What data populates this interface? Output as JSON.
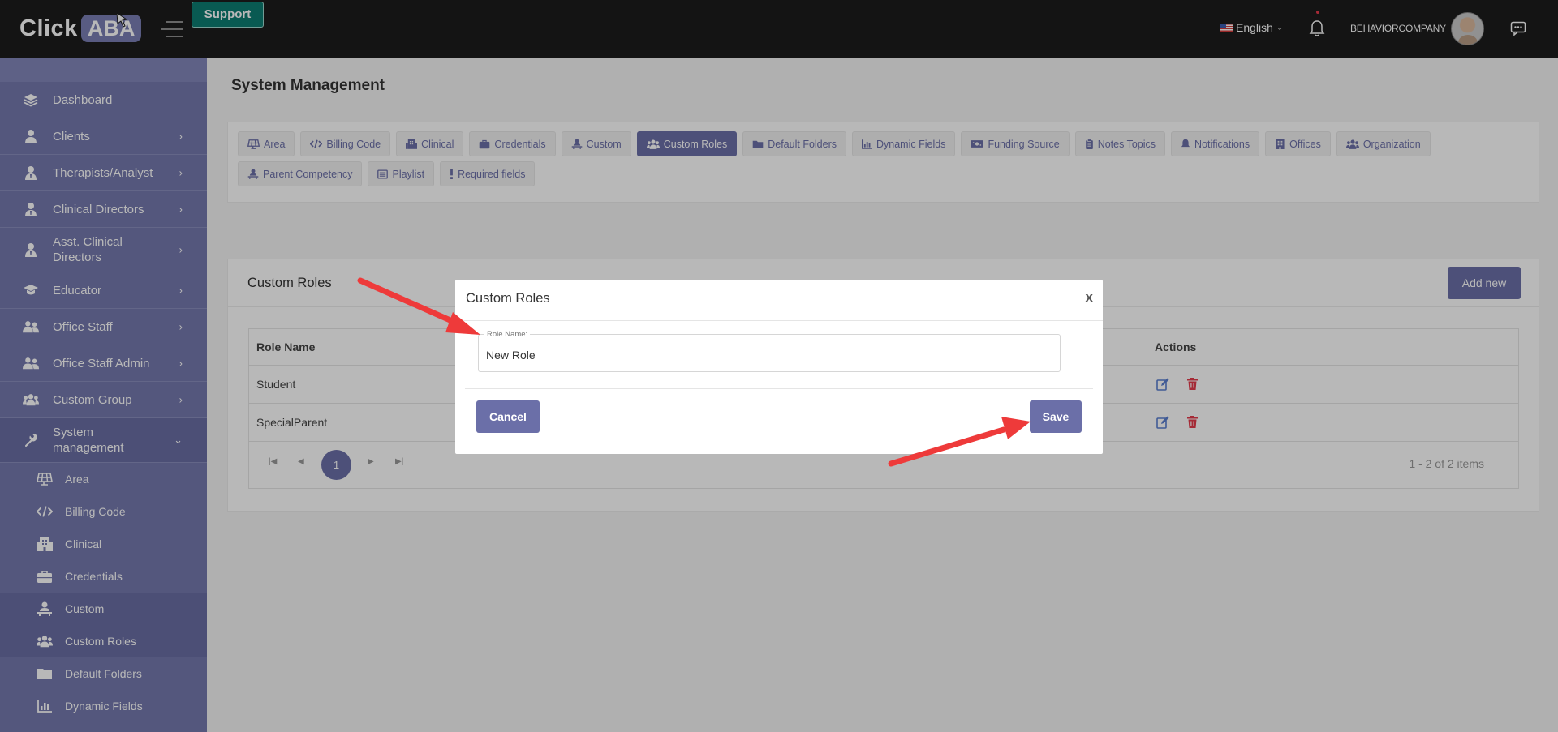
{
  "header": {
    "logo_click": "Click",
    "logo_aba": "ABA",
    "support_label": "Support",
    "language": "English",
    "company": "BEHAVIORCOMPANY"
  },
  "sidebar": {
    "items": [
      {
        "label": "Dashboard",
        "icon": "layers-icon"
      },
      {
        "label": "Clients",
        "icon": "user-icon"
      },
      {
        "label": "Therapists/Analyst",
        "icon": "user-tie-icon"
      },
      {
        "label": "Clinical Directors",
        "icon": "user-tie-icon"
      },
      {
        "label": "Asst. Clinical Directors",
        "icon": "user-tie-icon"
      },
      {
        "label": "Educator",
        "icon": "graduation-cap-icon"
      },
      {
        "label": "Office Staff",
        "icon": "user-group-icon"
      },
      {
        "label": "Office Staff Admin",
        "icon": "user-group-icon"
      },
      {
        "label": "Custom Group",
        "icon": "users-icon"
      },
      {
        "label": "System management",
        "icon": "wrench-icon"
      }
    ],
    "sub_items": [
      {
        "label": "Area",
        "icon": "solar-panel-icon"
      },
      {
        "label": "Billing Code",
        "icon": "code-icon"
      },
      {
        "label": "Clinical",
        "icon": "building-icon"
      },
      {
        "label": "Credentials",
        "icon": "briefcase-icon"
      },
      {
        "label": "Custom",
        "icon": "user-desk-icon"
      },
      {
        "label": "Custom Roles",
        "icon": "users-icon"
      },
      {
        "label": "Default Folders",
        "icon": "folder-icon"
      },
      {
        "label": "Dynamic Fields",
        "icon": "chart-icon"
      }
    ]
  },
  "main": {
    "page_title": "System Management",
    "tabs": [
      {
        "label": "Area",
        "icon": "solar-panel-icon"
      },
      {
        "label": "Billing Code",
        "icon": "code-icon"
      },
      {
        "label": "Clinical",
        "icon": "building-icon"
      },
      {
        "label": "Credentials",
        "icon": "briefcase-icon"
      },
      {
        "label": "Custom",
        "icon": "user-desk-icon"
      },
      {
        "label": "Custom Roles",
        "icon": "users-icon"
      },
      {
        "label": "Default Folders",
        "icon": "folder-icon"
      },
      {
        "label": "Dynamic Fields",
        "icon": "chart-icon"
      },
      {
        "label": "Funding Source",
        "icon": "money-icon"
      },
      {
        "label": "Notes Topics",
        "icon": "clipboard-icon"
      },
      {
        "label": "Notifications",
        "icon": "bell-icon"
      },
      {
        "label": "Offices",
        "icon": "building-icon"
      },
      {
        "label": "Organization",
        "icon": "users-icon"
      },
      {
        "label": "Parent Competency",
        "icon": "user-desk-icon"
      },
      {
        "label": "Playlist",
        "icon": "list-icon"
      },
      {
        "label": "Required fields",
        "icon": "exclamation-icon"
      }
    ],
    "active_tab": "Custom Roles",
    "card": {
      "title": "Custom Roles",
      "add_label": "Add new",
      "columns": [
        "Role Name",
        "Actions"
      ],
      "rows": [
        {
          "name": "Student"
        },
        {
          "name": "SpecialParent"
        }
      ],
      "pager": {
        "current_page": "1",
        "info": "1 - 2 of 2 items"
      }
    }
  },
  "modal": {
    "title": "Custom Roles",
    "close_label": "x",
    "field_label": "Role Name:",
    "field_value": "New Role",
    "cancel_label": "Cancel",
    "save_label": "Save"
  },
  "colors": {
    "accent": "#6b6fa8",
    "sidebar": "#7579ad",
    "topbar": "#1d1d1d",
    "support": "#0d7d72",
    "danger": "#e53b4b",
    "arrow": "#ee3a3a"
  }
}
